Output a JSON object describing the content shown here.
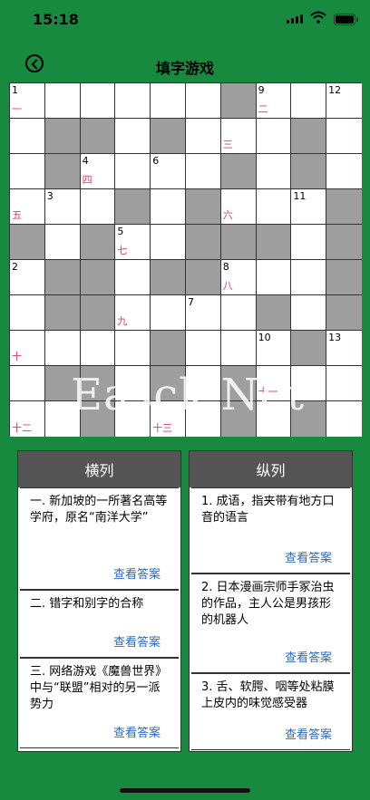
{
  "status_bar": {
    "time": "15:18",
    "icons": [
      "signal-icon",
      "wifi-icon",
      "battery-icon"
    ]
  },
  "header": {
    "title": "填字游戏",
    "back_icon": "back-circle-icon"
  },
  "grid": {
    "rows": [
      [
        {
          "n": "1",
          "l": "一"
        },
        {},
        {},
        {},
        {},
        {},
        {
          "b": true
        },
        {
          "n": "9",
          "l": "二"
        },
        {},
        {
          "n": "12"
        }
      ],
      [
        {},
        {
          "b": true
        },
        {
          "b": true
        },
        {},
        {
          "b": true
        },
        {},
        {
          "l": "三"
        },
        {},
        {
          "b": true
        },
        {}
      ],
      [
        {},
        {
          "b": true
        },
        {
          "n": "4",
          "l": "四"
        },
        {},
        {
          "n": "6"
        },
        {},
        {
          "b": true
        },
        {},
        {
          "b": true
        },
        {}
      ],
      [
        {
          "l": "五"
        },
        {
          "n": "3"
        },
        {},
        {
          "b": true
        },
        {},
        {
          "b": true
        },
        {
          "l": "六"
        },
        {},
        {
          "n": "11"
        },
        {
          "b": true
        }
      ],
      [
        {
          "b": true
        },
        {},
        {
          "b": true
        },
        {
          "n": "5",
          "l": "七"
        },
        {},
        {
          "b": true
        },
        {
          "b": true
        },
        {
          "b": true
        },
        {},
        {
          "b": true
        }
      ],
      [
        {
          "n": "2"
        },
        {
          "b": true
        },
        {
          "b": true
        },
        {},
        {
          "b": true
        },
        {
          "b": true
        },
        {
          "n": "8",
          "l": "八"
        },
        {},
        {},
        {
          "b": true
        }
      ],
      [
        {},
        {
          "b": true
        },
        {
          "b": true
        },
        {
          "l": "九"
        },
        {},
        {
          "n": "7"
        },
        {},
        {
          "b": true
        },
        {},
        {
          "b": true
        }
      ],
      [
        {
          "l": "十"
        },
        {},
        {},
        {},
        {
          "b": true
        },
        {},
        {},
        {
          "n": "10"
        },
        {
          "b": true
        },
        {
          "n": "13"
        }
      ],
      [
        {},
        {
          "b": true
        },
        {
          "b": true
        },
        {},
        {
          "b": true
        },
        {},
        {
          "b": true
        },
        {
          "l": "十一"
        },
        {},
        {}
      ],
      [
        {
          "l": "十二"
        },
        {},
        {
          "b": true
        },
        {},
        {
          "l": "十三"
        },
        {},
        {
          "b": true
        },
        {},
        {
          "b": true
        },
        {}
      ]
    ],
    "watermark": "Easck.Net"
  },
  "across": {
    "title": "横列",
    "clues": [
      {
        "text": "一. 新加坡的一所著名高等学府，原名“南洋大学”",
        "answer_label": "查看答案"
      },
      {
        "text": "二. 错字和别字的合称",
        "answer_label": "查看答案"
      },
      {
        "text": "三. 网络游戏《魔兽世界》中与“联盟”相对的另一派势力",
        "answer_label": "查看答案"
      }
    ]
  },
  "down": {
    "title": "纵列",
    "clues": [
      {
        "text": "1. 成语，指夹带有地方口音的语言",
        "answer_label": "查看答案"
      },
      {
        "text": "2. 日本漫画宗师手冢治虫的作品，主人公是男孩形的机器人",
        "answer_label": "查看答案"
      },
      {
        "text": "3. 舌、软腭、咽等处粘膜上皮内的味觉感受器",
        "answer_label": "查看答案"
      }
    ]
  },
  "colors": {
    "background": "#188a40",
    "black_cell": "#9e9e9e",
    "panel_header": "#555555",
    "link": "#2c6bb8",
    "label_red": "#e23b6a"
  }
}
